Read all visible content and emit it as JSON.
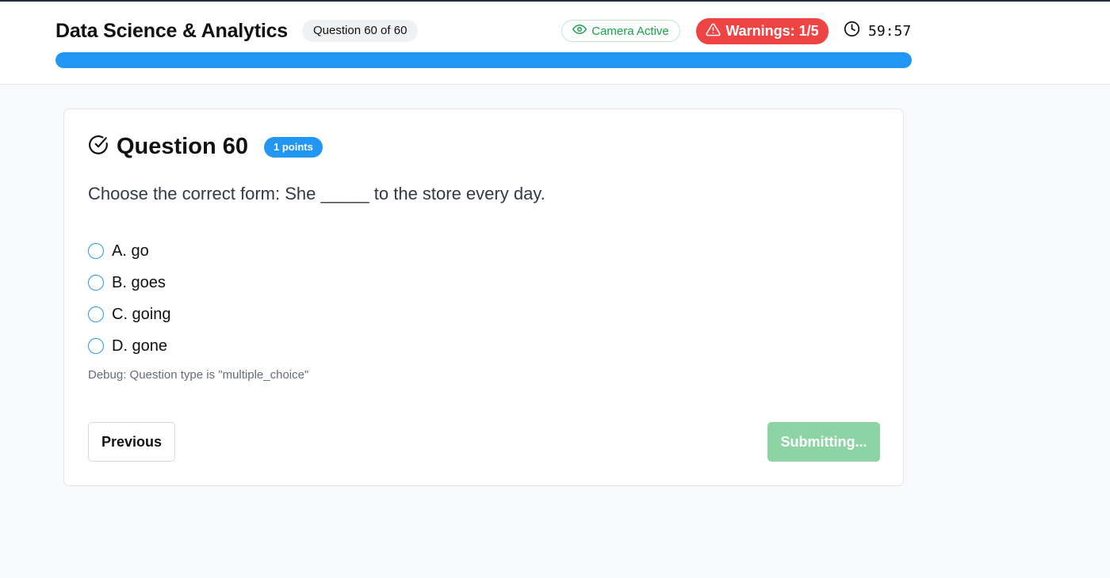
{
  "header": {
    "title": "Data Science & Analytics",
    "question_counter": "Question 60 of 60",
    "camera_status": "Camera Active",
    "warnings": "Warnings: 1/5",
    "timer": "59:57",
    "progress_percent": 100
  },
  "question": {
    "title": "Question 60",
    "points": "1 points",
    "text": "Choose the correct form: She _____ to the store every day.",
    "options": [
      {
        "label": "A. go"
      },
      {
        "label": "B. goes"
      },
      {
        "label": "C. going"
      },
      {
        "label": "D. gone"
      }
    ],
    "debug": "Debug: Question type is \"multiple_choice\""
  },
  "actions": {
    "previous_label": "Previous",
    "submit_label": "Submitting..."
  },
  "colors": {
    "accent": "#2196f3",
    "warning": "#ef4444",
    "camera": "#16a34a",
    "submit_disabled": "#8dd4a4"
  },
  "icons": {
    "camera": "eye-icon",
    "warning": "alert-triangle-icon",
    "timer": "clock-icon",
    "question": "check-circle-icon"
  }
}
